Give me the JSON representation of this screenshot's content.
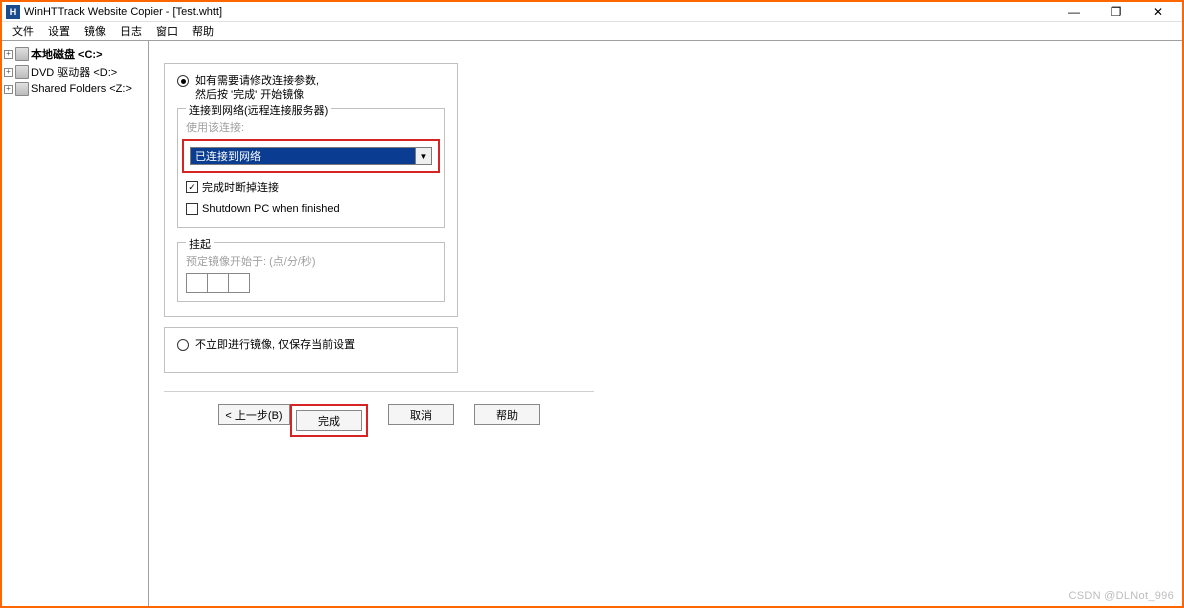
{
  "title": "WinHTTrack Website Copier - [Test.whtt]",
  "menu": {
    "file": "文件",
    "settings": "设置",
    "mirror": "镜像",
    "log": "日志",
    "window": "窗口",
    "help": "帮助"
  },
  "sidebar": {
    "items": [
      {
        "label": "本地磁盘 <C:>",
        "bold": true
      },
      {
        "label": "DVD 驱动器 <D:>",
        "bold": false
      },
      {
        "label": "Shared Folders <Z:>",
        "bold": false
      }
    ]
  },
  "radio1_line1": "如有需要请修改连接参数,",
  "radio1_line2": "然后按 '完成' 开始镜像",
  "fieldset1_legend": "连接到网络(远程连接服务器)",
  "fieldset1_hint": "使用该连接:",
  "dropdown_value": "已连接到网络",
  "checkbox_disconnect": "完成时断掉连接",
  "checkbox_shutdown": "Shutdown PC when finished",
  "fieldset2_legend": "挂起",
  "fieldset2_hint": "预定镜像开始于: (点/分/秒)",
  "radio2_text": "不立即进行镜像, 仅保存当前设置",
  "buttons": {
    "back": "< 上一步(B)",
    "finish": "完成",
    "cancel": "取消",
    "help": "帮助"
  },
  "watermark": "CSDN @DLNot_996"
}
